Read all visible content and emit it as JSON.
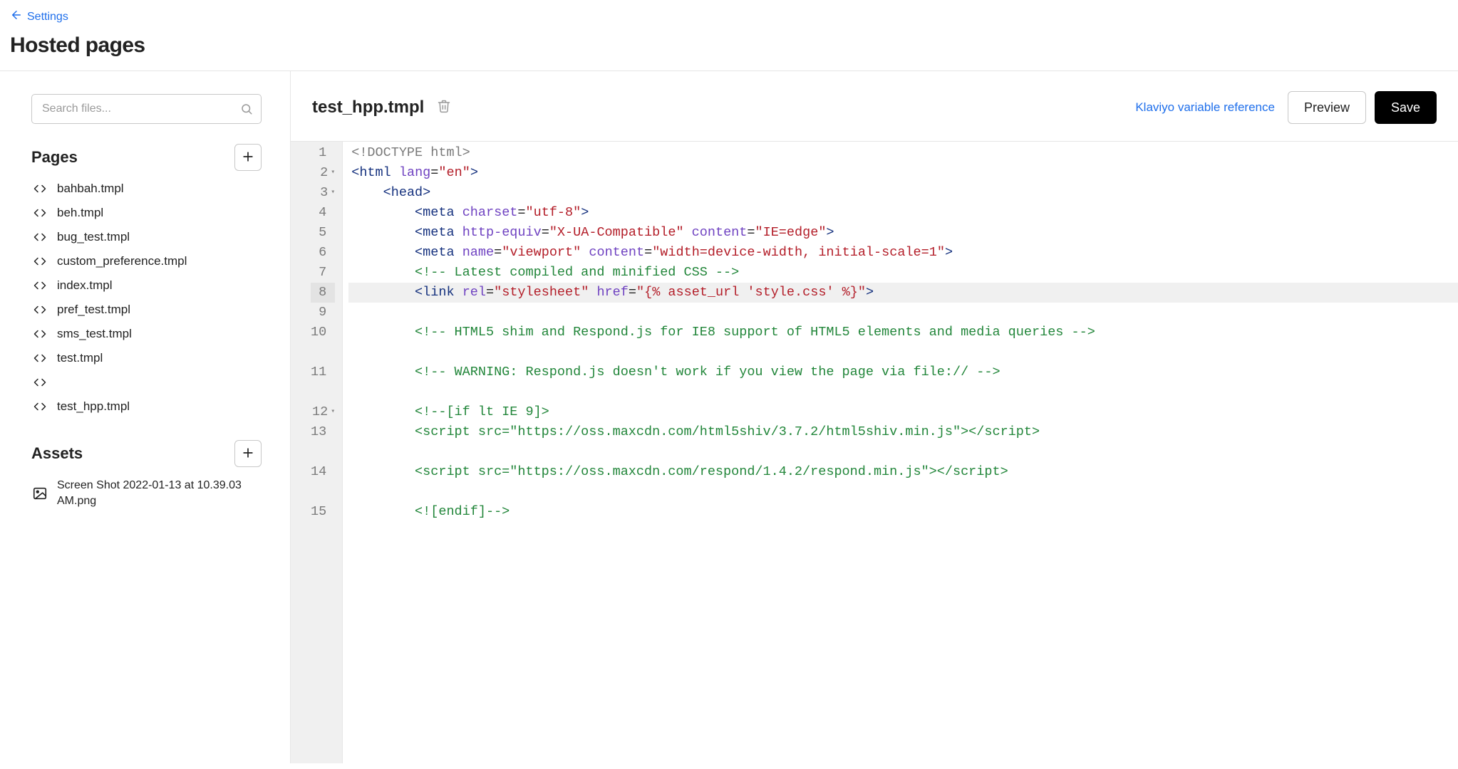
{
  "back_link": "Settings",
  "page_title": "Hosted pages",
  "search": {
    "placeholder": "Search files..."
  },
  "sections": {
    "pages": {
      "title": "Pages"
    },
    "assets": {
      "title": "Assets"
    }
  },
  "pages": [
    {
      "name": "bahbah.tmpl"
    },
    {
      "name": "beh.tmpl"
    },
    {
      "name": "bug_test.tmpl"
    },
    {
      "name": "custom_preference.tmpl"
    },
    {
      "name": "index.tmpl"
    },
    {
      "name": "pref_test.tmpl"
    },
    {
      "name": "sms_test.tmpl"
    },
    {
      "name": "test.tmpl"
    },
    {
      "name": ""
    },
    {
      "name": "test_hpp.tmpl"
    }
  ],
  "assets": [
    {
      "name": "Screen Shot 2022-01-13 at 10.39.03 AM.png",
      "type": "image"
    }
  ],
  "editor": {
    "filename": "test_hpp.tmpl",
    "var_ref_label": "Klaviyo variable reference",
    "preview_label": "Preview",
    "save_label": "Save",
    "highlighted_line": 8,
    "gutter": [
      {
        "n": "1"
      },
      {
        "n": "2",
        "fold": true
      },
      {
        "n": "3",
        "fold": true
      },
      {
        "n": "4"
      },
      {
        "n": "5"
      },
      {
        "n": "6"
      },
      {
        "n": "7"
      },
      {
        "n": "8"
      },
      {
        "n": "9"
      },
      {
        "n": "10",
        "wrap": 2
      },
      {
        "n": "11",
        "wrap": 2
      },
      {
        "n": "12",
        "fold": true
      },
      {
        "n": "13",
        "wrap": 2
      },
      {
        "n": "14",
        "wrap": 2
      },
      {
        "n": "15"
      }
    ],
    "code_lines": [
      {
        "indent": 0,
        "tokens": [
          {
            "c": "doctype",
            "t": "<!DOCTYPE html>"
          }
        ]
      },
      {
        "indent": 0,
        "tokens": [
          {
            "c": "angle",
            "t": "<"
          },
          {
            "c": "tag",
            "t": "html"
          },
          {
            "c": "",
            "t": " "
          },
          {
            "c": "attr",
            "t": "lang"
          },
          {
            "c": "eq",
            "t": "="
          },
          {
            "c": "str",
            "t": "\"en\""
          },
          {
            "c": "angle",
            "t": ">"
          }
        ]
      },
      {
        "indent": 1,
        "tokens": [
          {
            "c": "angle",
            "t": "<"
          },
          {
            "c": "tag",
            "t": "head"
          },
          {
            "c": "angle",
            "t": ">"
          }
        ]
      },
      {
        "indent": 2,
        "tokens": [
          {
            "c": "angle",
            "t": "<"
          },
          {
            "c": "tag",
            "t": "meta"
          },
          {
            "c": "",
            "t": " "
          },
          {
            "c": "attr",
            "t": "charset"
          },
          {
            "c": "eq",
            "t": "="
          },
          {
            "c": "str",
            "t": "\"utf-8\""
          },
          {
            "c": "angle",
            "t": ">"
          }
        ]
      },
      {
        "indent": 2,
        "tokens": [
          {
            "c": "angle",
            "t": "<"
          },
          {
            "c": "tag",
            "t": "meta"
          },
          {
            "c": "",
            "t": " "
          },
          {
            "c": "attr",
            "t": "http-equiv"
          },
          {
            "c": "eq",
            "t": "="
          },
          {
            "c": "str",
            "t": "\"X-UA-Compatible\""
          },
          {
            "c": "",
            "t": " "
          },
          {
            "c": "attr",
            "t": "content"
          },
          {
            "c": "eq",
            "t": "="
          },
          {
            "c": "str",
            "t": "\"IE=edge\""
          },
          {
            "c": "angle",
            "t": ">"
          }
        ]
      },
      {
        "indent": 2,
        "tokens": [
          {
            "c": "angle",
            "t": "<"
          },
          {
            "c": "tag",
            "t": "meta"
          },
          {
            "c": "",
            "t": " "
          },
          {
            "c": "attr",
            "t": "name"
          },
          {
            "c": "eq",
            "t": "="
          },
          {
            "c": "str",
            "t": "\"viewport\""
          },
          {
            "c": "",
            "t": " "
          },
          {
            "c": "attr",
            "t": "content"
          },
          {
            "c": "eq",
            "t": "="
          },
          {
            "c": "str",
            "t": "\"width=device-width, initial-scale=1\""
          },
          {
            "c": "angle",
            "t": ">"
          }
        ]
      },
      {
        "indent": 2,
        "tokens": [
          {
            "c": "cmt",
            "t": "<!-- Latest compiled and minified CSS -->"
          }
        ]
      },
      {
        "indent": 2,
        "hl": true,
        "tokens": [
          {
            "c": "angle",
            "t": "<"
          },
          {
            "c": "tag",
            "t": "link"
          },
          {
            "c": "",
            "t": " "
          },
          {
            "c": "attr",
            "t": "rel"
          },
          {
            "c": "eq",
            "t": "="
          },
          {
            "c": "str",
            "t": "\"stylesheet\""
          },
          {
            "c": "",
            "t": " "
          },
          {
            "c": "attr",
            "t": "href"
          },
          {
            "c": "eq",
            "t": "="
          },
          {
            "c": "str",
            "t": "\"{% asset_url 'style.css' %}\""
          },
          {
            "c": "angle",
            "t": ">"
          }
        ]
      },
      {
        "indent": 0,
        "tokens": []
      },
      {
        "indent": 2,
        "wrap": true,
        "tokens": [
          {
            "c": "cmt",
            "t": "<!-- HTML5 shim and Respond.js for IE8 support of HTML5 elements and media queries -->"
          }
        ]
      },
      {
        "indent": 2,
        "wrap": true,
        "tokens": [
          {
            "c": "cmt",
            "t": "<!-- WARNING: Respond.js doesn't work if you view the page via file:// -->"
          }
        ]
      },
      {
        "indent": 2,
        "tokens": [
          {
            "c": "cmt",
            "t": "<!--[if lt IE 9]>"
          }
        ]
      },
      {
        "indent": 2,
        "wrap": true,
        "tokens": [
          {
            "c": "cmt",
            "t": "<script src=\"https://oss.maxcdn.com/html5shiv/3.7.2/html5shiv.min.js\"></script>"
          }
        ]
      },
      {
        "indent": 2,
        "wrap": true,
        "tokens": [
          {
            "c": "cmt",
            "t": "<script src=\"https://oss.maxcdn.com/respond/1.4.2/respond.min.js\"></script>"
          }
        ]
      },
      {
        "indent": 2,
        "tokens": [
          {
            "c": "cmt",
            "t": "<![endif]-->"
          }
        ]
      }
    ]
  }
}
